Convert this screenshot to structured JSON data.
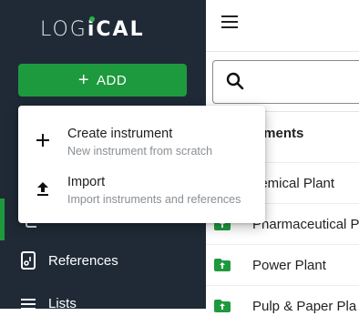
{
  "sidebar": {
    "logo_light": "LOG",
    "logo_i": "i",
    "logo_bold": "CAL",
    "add_label": "ADD",
    "nav": [
      {
        "label": "References",
        "icon": "references-icon"
      },
      {
        "label": "Lists",
        "icon": "lists-icon"
      }
    ]
  },
  "menu": {
    "items": [
      {
        "title": "Create instrument",
        "subtitle": "New instrument from scratch",
        "icon": "plus-icon"
      },
      {
        "title": "Import",
        "subtitle": "Import instruments and references",
        "icon": "upload-icon"
      }
    ]
  },
  "main": {
    "column_header": "uments",
    "rows": [
      {
        "label": "hemical Plant"
      },
      {
        "label": "Pharmaceutical P"
      },
      {
        "label": "Power Plant"
      },
      {
        "label": "Pulp & Paper Pla"
      }
    ]
  },
  "colors": {
    "sidebar_bg": "#1f2a36",
    "accent_green": "#1e9a3e",
    "logo_dot": "#29b34a"
  }
}
